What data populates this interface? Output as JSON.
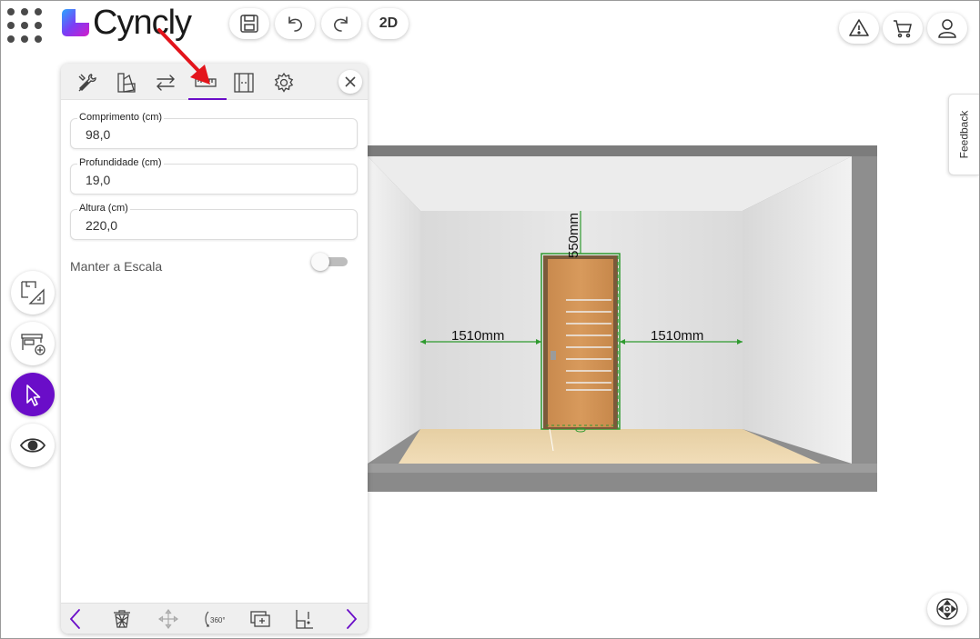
{
  "app": {
    "logo_text": "Cyncly",
    "brand_color": "#6a0dc8"
  },
  "toolbar": {
    "save_icon": "save-icon",
    "undo_icon": "undo-icon",
    "redo_icon": "redo-icon",
    "view_2d_label": "2D",
    "warning_icon": "warning-icon",
    "cart_icon": "cart-icon",
    "user_icon": "user-icon"
  },
  "feedback_label": "Feedback",
  "left_tools": [
    {
      "name": "floorplan-tool-icon"
    },
    {
      "name": "add-furniture-icon"
    },
    {
      "name": "select-cursor-icon",
      "active": true
    },
    {
      "name": "visibility-eye-icon"
    }
  ],
  "panel": {
    "tabs": [
      {
        "name": "tools-icon"
      },
      {
        "name": "materials-icon"
      },
      {
        "name": "swap-icon"
      },
      {
        "name": "ruler-icon",
        "active": true
      },
      {
        "name": "door-panel-icon"
      },
      {
        "name": "settings-icon"
      }
    ],
    "fields": [
      {
        "label": "Comprimento (cm)",
        "value": "98,0"
      },
      {
        "label": "Profundidade (cm)",
        "value": "19,0"
      },
      {
        "label": "Altura (cm)",
        "value": "220,0"
      }
    ],
    "keep_scale_label": "Manter a Escala",
    "keep_scale_on": false,
    "footer": [
      {
        "name": "prev-arrow-icon"
      },
      {
        "name": "delete-icon"
      },
      {
        "name": "move-icon"
      },
      {
        "name": "rotate-360-icon",
        "label": "360°"
      },
      {
        "name": "duplicate-icon"
      },
      {
        "name": "alert-item-icon"
      },
      {
        "name": "next-arrow-icon"
      }
    ]
  },
  "scene": {
    "dim_left": "1510mm",
    "dim_right": "1510mm",
    "dim_top": "550mm"
  }
}
